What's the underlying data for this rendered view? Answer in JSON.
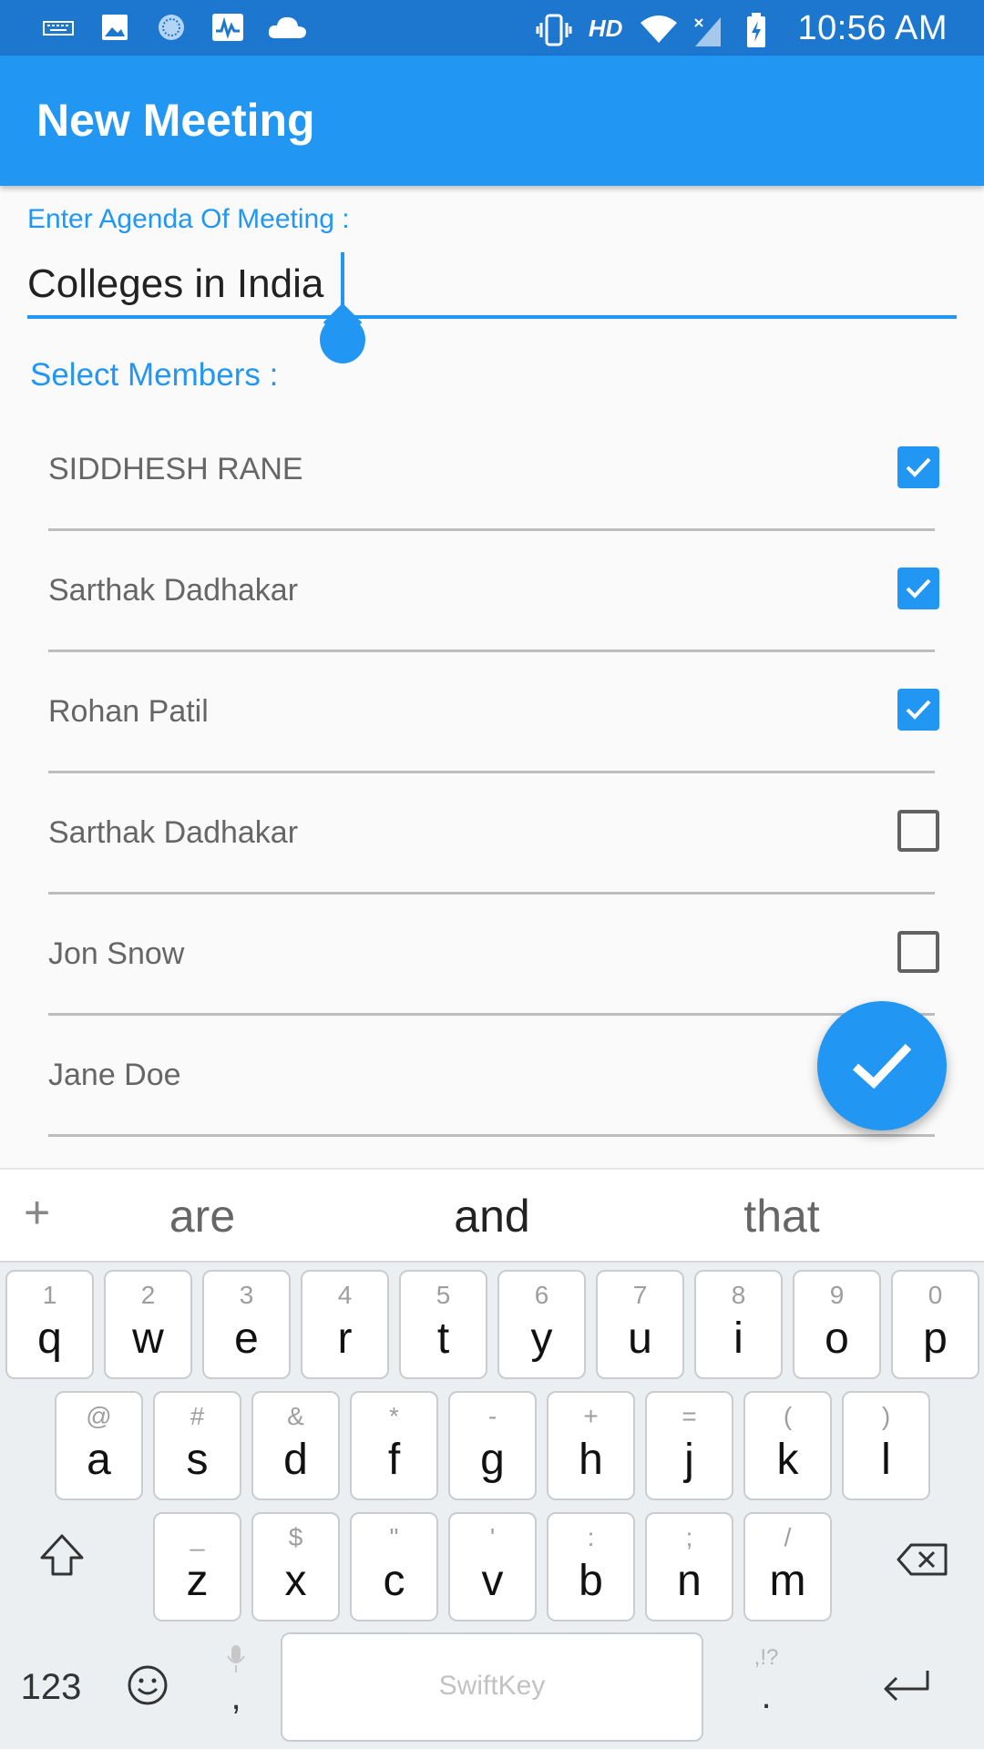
{
  "status_bar": {
    "time": "10:56 AM",
    "network_label": "HD",
    "icons": [
      "keyboard-icon",
      "image-icon",
      "chakra-icon",
      "activity-icon",
      "cloud-icon",
      "vibrate-icon",
      "wifi-icon",
      "signal-icon",
      "battery-charging-icon"
    ]
  },
  "app_bar": {
    "title": "New Meeting"
  },
  "form": {
    "agenda_label": "Enter Agenda Of Meeting :",
    "agenda_value": "Colleges in India",
    "members_label": "Select Members :"
  },
  "members": [
    {
      "name": "SIDDHESH RANE",
      "checked": true
    },
    {
      "name": "Sarthak Dadhakar",
      "checked": true
    },
    {
      "name": "Rohan Patil",
      "checked": true
    },
    {
      "name": "Sarthak Dadhakar",
      "checked": false
    },
    {
      "name": "Jon Snow",
      "checked": false
    },
    {
      "name": "Jane Doe",
      "checked": false
    }
  ],
  "fab": {
    "icon": "check-icon"
  },
  "keyboard": {
    "suggestions": [
      "are",
      "and",
      "that"
    ],
    "row1": [
      {
        "hint": "1",
        "char": "q"
      },
      {
        "hint": "2",
        "char": "w"
      },
      {
        "hint": "3",
        "char": "e"
      },
      {
        "hint": "4",
        "char": "r"
      },
      {
        "hint": "5",
        "char": "t"
      },
      {
        "hint": "6",
        "char": "y"
      },
      {
        "hint": "7",
        "char": "u"
      },
      {
        "hint": "8",
        "char": "i"
      },
      {
        "hint": "9",
        "char": "o"
      },
      {
        "hint": "0",
        "char": "p"
      }
    ],
    "row2": [
      {
        "hint": "@",
        "char": "a"
      },
      {
        "hint": "#",
        "char": "s"
      },
      {
        "hint": "&",
        "char": "d"
      },
      {
        "hint": "*",
        "char": "f"
      },
      {
        "hint": "-",
        "char": "g"
      },
      {
        "hint": "+",
        "char": "h"
      },
      {
        "hint": "=",
        "char": "j"
      },
      {
        "hint": "(",
        "char": "k"
      },
      {
        "hint": ")",
        "char": "l"
      }
    ],
    "row3": [
      {
        "hint": "_",
        "char": "z"
      },
      {
        "hint": "$",
        "char": "x"
      },
      {
        "hint": "\"",
        "char": "c"
      },
      {
        "hint": "'",
        "char": "v"
      },
      {
        "hint": ":",
        "char": "b"
      },
      {
        "hint": ";",
        "char": "n"
      },
      {
        "hint": "/",
        "char": "m"
      }
    ],
    "numbers_label": "123",
    "comma_label": ",",
    "period_label": ".",
    "period_hint": ",!?",
    "space_label": "SwiftKey"
  }
}
